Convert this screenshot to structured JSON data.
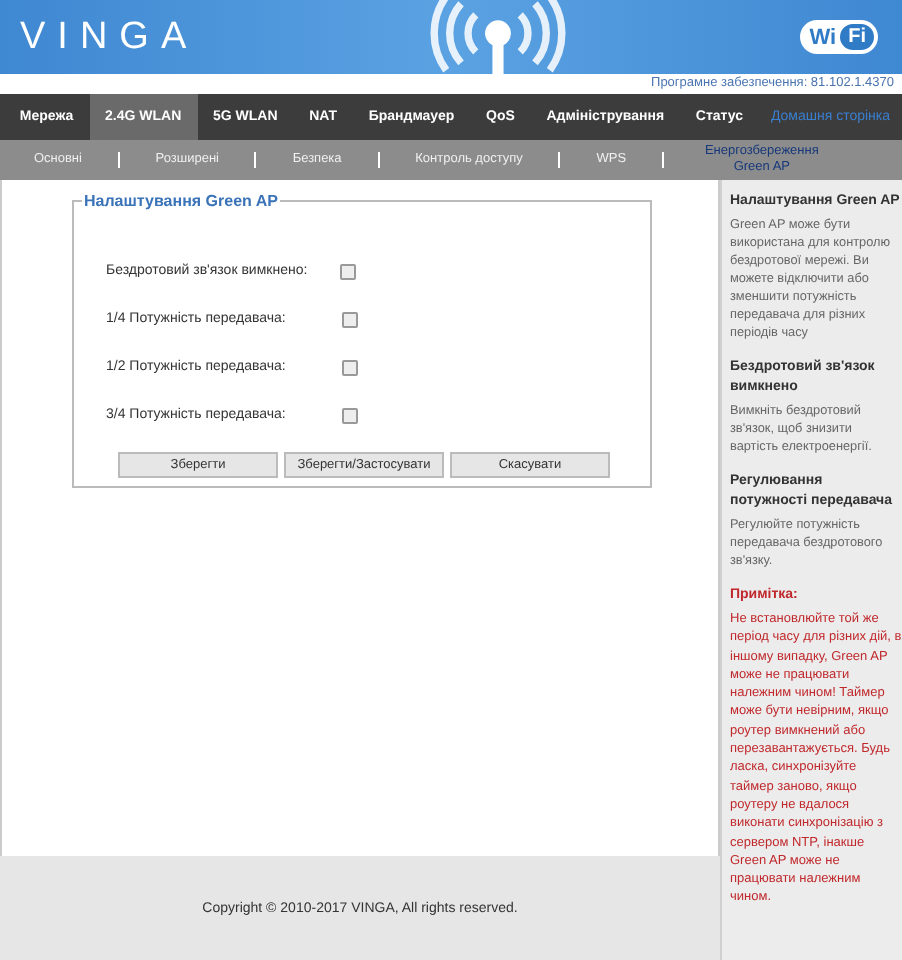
{
  "header": {
    "logo": "VINGA",
    "wifi_badge": [
      "Wi",
      "Fi"
    ],
    "firmware": "Програмне забезпечення: 81.102.1.4370"
  },
  "nav": [
    {
      "label": "Мережа",
      "selected": false,
      "kind": "tab"
    },
    {
      "label": "2.4G WLAN",
      "selected": true,
      "kind": "tab"
    },
    {
      "label": "5G WLAN",
      "selected": false,
      "kind": "tab"
    },
    {
      "label": "NAT",
      "selected": false,
      "kind": "tab"
    },
    {
      "label": "Брандмауер",
      "selected": false,
      "kind": "tab"
    },
    {
      "label": "QoS",
      "selected": false,
      "kind": "tab"
    },
    {
      "label": "Адміністрування",
      "selected": false,
      "kind": "tab"
    },
    {
      "label": "Статус",
      "selected": false,
      "kind": "tab"
    },
    {
      "label": "Домашня сторінка",
      "selected": false,
      "kind": "link"
    }
  ],
  "subnav": [
    {
      "label": "Основні",
      "selected": false
    },
    {
      "label": "Розширені",
      "selected": false
    },
    {
      "label": "Безпека",
      "selected": false
    },
    {
      "label": "Контроль доступу",
      "selected": false
    },
    {
      "label": "WPS",
      "selected": false
    },
    {
      "label": "Енергозбереження Green AP",
      "selected": true
    }
  ],
  "form": {
    "legend": "Налаштування Green AP",
    "fields": [
      {
        "label": "Бездротовий зв'язок вимкнено:",
        "checked": false
      },
      {
        "label": "1/4 Потужність передавача:",
        "checked": false
      },
      {
        "label": "1/2 Потужність передавача:",
        "checked": false
      },
      {
        "label": "3/4 Потужність передавача:",
        "checked": false
      }
    ],
    "buttons": [
      "Зберегти",
      "Зберегти/Застосувати",
      "Скасувати"
    ]
  },
  "sidebar": [
    {
      "kind": "help",
      "heading": "Налаштування Green AP",
      "text": "Green AP може бути використана для контролю бездротової мережі. Ви можете відключити або зменшити потужність передавача для різних періодів часу"
    },
    {
      "kind": "help",
      "heading": "Бездротовий зв'язок вимкнено",
      "text": "Вимкніть бездротовий зв'язок, щоб знизити вартість електроенергії."
    },
    {
      "kind": "help",
      "heading": "Регулювання потужності передавача",
      "text": "Регулюйте потужність передавача бездротового зв'язку."
    },
    {
      "kind": "note",
      "heading": "Примітка:",
      "text": "Не встановлюйте той же період часу для різних дій, в іншому випадку, Green AP може не працювати належним чином! Таймер може бути невірним, якщо роутер вимкнений або перезавантажується. Будь ласка, синхронізуйте таймер заново, якщо роутеру не вдалося виконати синхронізацію з сервером NTP, інакше Green AP може не працювати належним чином."
    }
  ],
  "footer": "Copyright © 2010-2017 VINGA, All rights reserved."
}
